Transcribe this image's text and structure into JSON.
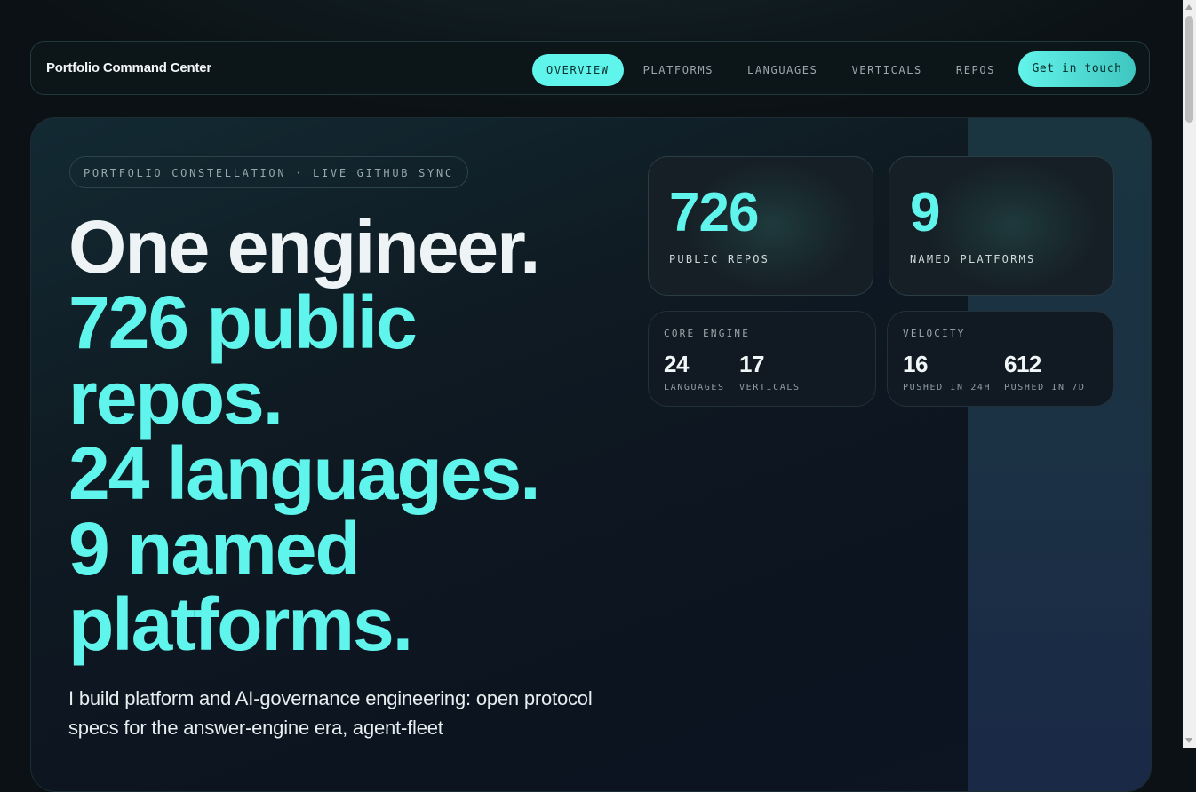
{
  "nav": {
    "brand": "Portfolio Command Center",
    "links": [
      "OVERVIEW",
      "PLATFORMS",
      "LANGUAGES",
      "VERTICALS",
      "REPOS"
    ],
    "active": "OVERVIEW",
    "cta": "Get in touch"
  },
  "hero": {
    "eyebrow": "PORTFOLIO CONSTELLATION · LIVE GITHUB SYNC",
    "headline": {
      "line1": "One engineer.",
      "line2": "726 public repos.",
      "line3": "24 languages.",
      "line4": "9 named platforms."
    },
    "lede": "I build platform and AI-governance engineering: open protocol specs for the answer-engine era, agent-fleet"
  },
  "stats": {
    "repos": {
      "value": "726",
      "label": "PUBLIC REPOS"
    },
    "platforms": {
      "value": "9",
      "label": "NAMED PLATFORMS"
    },
    "core_engine": {
      "title": "CORE ENGINE",
      "metrics": [
        {
          "value": "24",
          "label": "LANGUAGES"
        },
        {
          "value": "17",
          "label": "VERTICALS"
        }
      ]
    },
    "velocity": {
      "title": "VELOCITY",
      "metrics": [
        {
          "value": "16",
          "label": "PUSHED IN 24H"
        },
        {
          "value": "612",
          "label": "PUSHED IN 7D"
        }
      ]
    }
  },
  "colors": {
    "accent": "#5ff5ec",
    "background": "#0b1114",
    "card": "#161f26"
  }
}
